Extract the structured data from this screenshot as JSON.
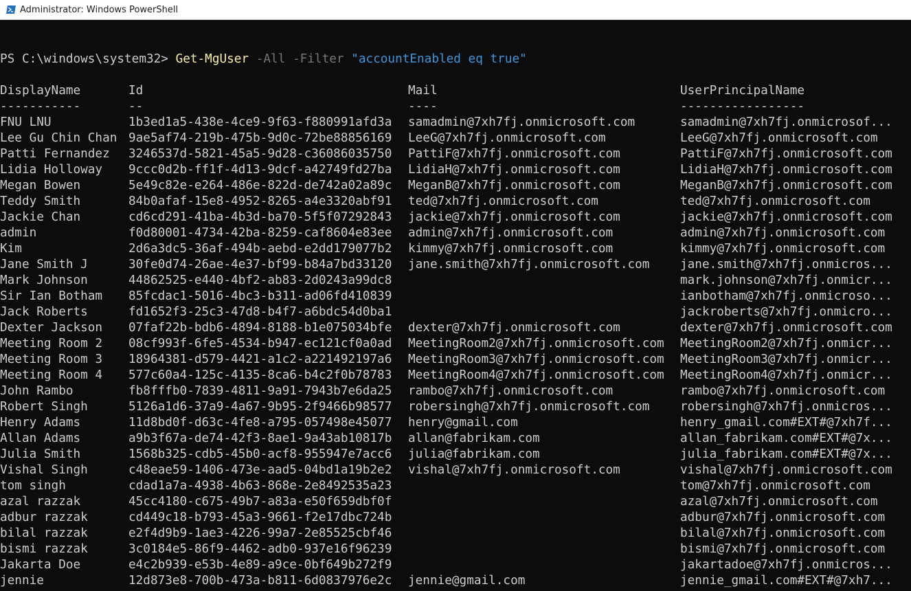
{
  "window": {
    "title": "Administrator: Windows PowerShell"
  },
  "prompt": {
    "path": "PS C:\\windows\\system32> ",
    "cmdlet": "Get-MgUser",
    "param1": " -All",
    "param2": " -Filter",
    "filter_string": " \"accountEnabled eq true\""
  },
  "table": {
    "headers": [
      "DisplayName",
      "Id",
      "Mail",
      "UserPrincipalName"
    ],
    "separators": [
      "-----------",
      "--",
      "----",
      "-----------------"
    ],
    "rows": [
      [
        "FNU LNU",
        "1b3ed1a5-438e-4ce9-9f63-f880991afd3a",
        "samadmin@7xh7fj.onmicrosoft.com",
        "samadmin@7xh7fj.onmicrosof..."
      ],
      [
        "Lee Gu Chin Chan",
        "9ae5af74-219b-475b-9d0c-72be88856169",
        "LeeG@7xh7fj.onmicrosoft.com",
        "LeeG@7xh7fj.onmicrosoft.com"
      ],
      [
        "Patti Fernandez",
        "3246537d-5821-45a5-9d28-c36086035750",
        "PattiF@7xh7fj.onmicrosoft.com",
        "PattiF@7xh7fj.onmicrosoft.com"
      ],
      [
        "Lidia Holloway",
        "9ccc0d2b-ff1f-4d13-9dcf-a42749fd27ba",
        "LidiaH@7xh7fj.onmicrosoft.com",
        "LidiaH@7xh7fj.onmicrosoft.com"
      ],
      [
        "Megan Bowen",
        "5e49c82e-e264-486e-822d-de742a02a89c",
        "MeganB@7xh7fj.onmicrosoft.com",
        "MeganB@7xh7fj.onmicrosoft.com"
      ],
      [
        "Teddy Smith",
        "84b0afaf-15e8-4952-8265-a4e3320abf91",
        "ted@7xh7fj.onmicrosoft.com",
        "ted@7xh7fj.onmicrosoft.com"
      ],
      [
        "Jackie Chan",
        "cd6cd291-41ba-4b3d-ba70-5f5f07292843",
        "jackie@7xh7fj.onmicrosoft.com",
        "jackie@7xh7fj.onmicrosoft.com"
      ],
      [
        "admin",
        "f0d80001-4734-42ba-8259-caf8604e83ee",
        "admin@7xh7fj.onmicrosoft.com",
        "admin@7xh7fj.onmicrosoft.com"
      ],
      [
        "Kim",
        "2d6a3dc5-36af-494b-aebd-e2dd179077b2",
        "kimmy@7xh7fj.onmicrosoft.com",
        "kimmy@7xh7fj.onmicrosoft.com"
      ],
      [
        "Jane Smith J",
        "30fe0d74-26ae-4e37-bf99-b84a7bd33120",
        "jane.smith@7xh7fj.onmicrosoft.com",
        "jane.smith@7xh7fj.onmicros..."
      ],
      [
        "Mark Johnson",
        "44862525-e440-4bf2-ab83-2d0243a99dc8",
        "",
        "mark.johnson@7xh7fj.onmicr..."
      ],
      [
        "Sir Ian Botham",
        "85fcdac1-5016-4bc3-b311-ad06fd410839",
        "",
        "ianbotham@7xh7fj.onmicroso..."
      ],
      [
        "Jack Roberts",
        "fd1652f3-25c3-47d8-b4f7-a6bdc54d0ba1",
        "",
        "jackroberts@7xh7fj.onmicro..."
      ],
      [
        "Dexter Jackson",
        "07faf22b-bdb6-4894-8188-b1e075034bfe",
        "dexter@7xh7fj.onmicrosoft.com",
        "dexter@7xh7fj.onmicrosoft.com"
      ],
      [
        "Meeting Room 2",
        "08cf993f-6fe5-4534-b947-ec121cf0a0ad",
        "MeetingRoom2@7xh7fj.onmicrosoft.com",
        "MeetingRoom2@7xh7fj.onmicr..."
      ],
      [
        "Meeting Room 3",
        "18964381-d579-4421-a1c2-a221492197a6",
        "MeetingRoom3@7xh7fj.onmicrosoft.com",
        "MeetingRoom3@7xh7fj.onmicr..."
      ],
      [
        "Meeting Room 4",
        "577c60a4-125c-4135-8ca6-b4c2f0b78783",
        "MeetingRoom4@7xh7fj.onmicrosoft.com",
        "MeetingRoom4@7xh7fj.onmicr..."
      ],
      [
        "John Rambo",
        "fb8fffb0-7839-4811-9a91-7943b7e6da25",
        "rambo@7xh7fj.onmicrosoft.com",
        "rambo@7xh7fj.onmicrosoft.com"
      ],
      [
        "Robert Singh",
        "5126a1d6-37a9-4a67-9b95-2f9466b98577",
        "robersingh@7xh7fj.onmicrosoft.com",
        "robersingh@7xh7fj.onmicros..."
      ],
      [
        "Henry Adams",
        "11d8bd0f-d63c-4fe8-a795-057498e45077",
        "henry@gmail.com",
        "henry_gmail.com#EXT#@7xh7f..."
      ],
      [
        "Allan Adams",
        "a9b3f67a-de74-42f3-8ae1-9a43ab10817b",
        "allan@fabrikam.com",
        "allan_fabrikam.com#EXT#@7x..."
      ],
      [
        "Julia Smith",
        "1568b325-cdb5-45b0-acf8-955947e7acc6",
        "julia@fabrikam.com",
        "julia_fabrikam.com#EXT#@7x..."
      ],
      [
        "Vishal Singh",
        "c48eae59-1406-473e-aad5-04bd1a19b2e2",
        "vishal@7xh7fj.onmicrosoft.com",
        "vishal@7xh7fj.onmicrosoft.com"
      ],
      [
        "tom singh",
        "cdad1a7a-4938-4b63-868e-2e8492535a23",
        "",
        "tom@7xh7fj.onmicrosoft.com"
      ],
      [
        "azal razzak",
        "45cc4180-c675-49b7-a83a-e50f659dbf0f",
        "",
        "azal@7xh7fj.onmicrosoft.com"
      ],
      [
        "adbur razzak",
        "cd449c18-b793-45a3-9661-f2e17dbc724b",
        "",
        "adbur@7xh7fj.onmicrosoft.com"
      ],
      [
        "bilal razzak",
        "e2f4d9b9-1ae3-4226-99a7-2e85525cbf46",
        "",
        "bilal@7xh7fj.onmicrosoft.com"
      ],
      [
        "bismi razzak",
        "3c0184e5-86f9-4462-adb0-937e16f96239",
        "",
        "bismi@7xh7fj.onmicrosoft.com"
      ],
      [
        "Jakarta Doe",
        "e4c2b939-e53b-4e89-a9ce-0bf649b272f9",
        "",
        "jakartadoe@7xh7fj.onmicros..."
      ],
      [
        "jennie",
        "12d873e8-700b-473a-b811-6d0837976e2c",
        "jennie@gmail.com",
        "jennie_gmail.com#EXT#@7xh7..."
      ]
    ]
  },
  "colors": {
    "background": "#0c0c0c",
    "text": "#cccccc",
    "cmdlet": "#f9f1a5",
    "parameter": "#767676",
    "string": "#3a96dd"
  },
  "icons": {
    "app_icon": "powershell-icon"
  }
}
